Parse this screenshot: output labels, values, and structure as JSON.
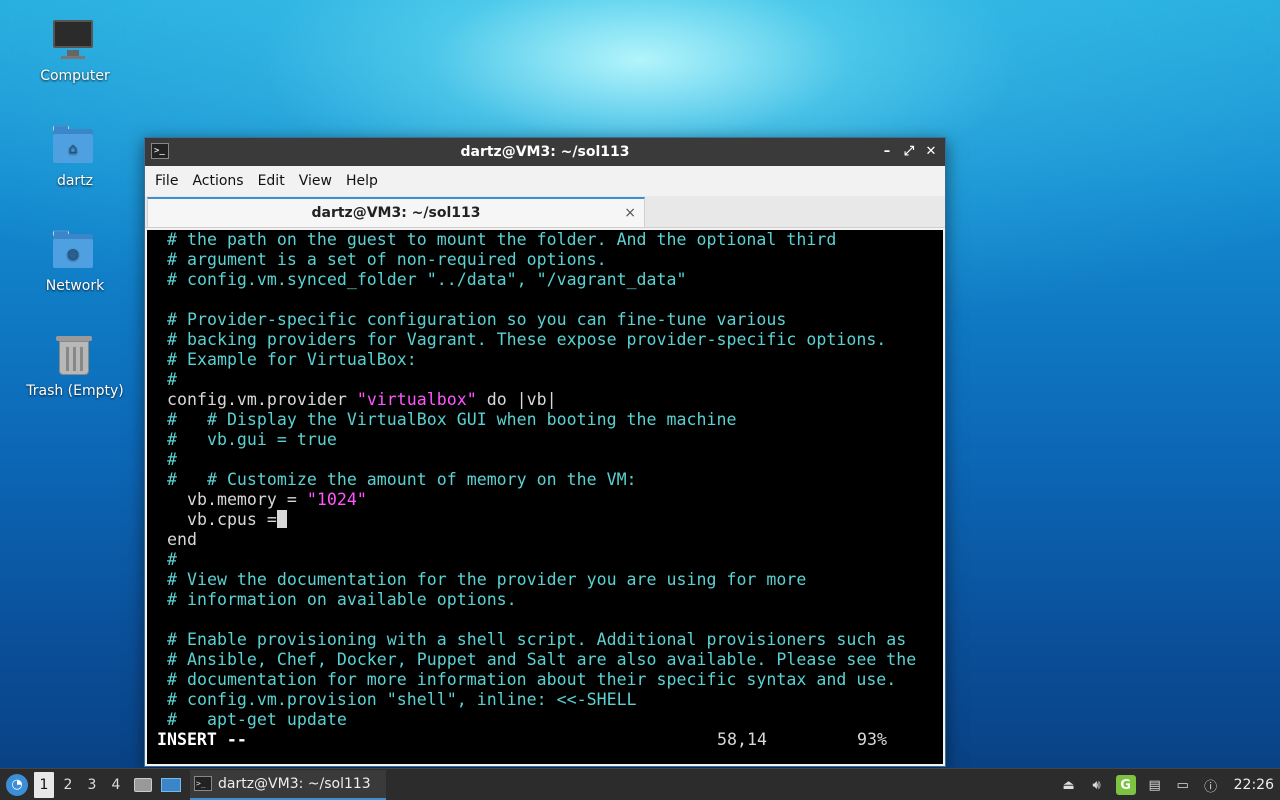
{
  "desktop": {
    "icons": [
      {
        "label": "Computer"
      },
      {
        "label": "dartz"
      },
      {
        "label": "Network"
      },
      {
        "label": "Trash (Empty)"
      }
    ]
  },
  "window": {
    "title": "dartz@VM3: ~/sol113",
    "controls": {
      "minimize": "–",
      "maximize": "⤢",
      "close": "✕"
    },
    "menu": [
      "File",
      "Actions",
      "Edit",
      "View",
      "Help"
    ],
    "tab": {
      "label": "dartz@VM3: ~/sol113",
      "close": "×"
    }
  },
  "terminal": {
    "lines": [
      [
        {
          "t": "# the path on the guest to mount the folder. And the optional third",
          "c": "cm"
        }
      ],
      [
        {
          "t": "# argument is a set of non-required options.",
          "c": "cm"
        }
      ],
      [
        {
          "t": "# config.vm.synced_folder \"../data\", \"/vagrant_data\"",
          "c": "cm"
        }
      ],
      [],
      [
        {
          "t": "# Provider-specific configuration so you can fine-tune various",
          "c": "cm"
        }
      ],
      [
        {
          "t": "# backing providers for Vagrant. These expose provider-specific options.",
          "c": "cm"
        }
      ],
      [
        {
          "t": "# Example for VirtualBox:",
          "c": "cm"
        }
      ],
      [
        {
          "t": "#",
          "c": "cm"
        }
      ],
      [
        {
          "t": "config.vm.provider ",
          "c": "code"
        },
        {
          "t": "\"virtualbox\"",
          "c": "str"
        },
        {
          "t": " do |vb|",
          "c": "code"
        }
      ],
      [
        {
          "t": "#   # Display the VirtualBox GUI when booting the machine",
          "c": "cm"
        }
      ],
      [
        {
          "t": "#   vb.gui = true",
          "c": "cm"
        }
      ],
      [
        {
          "t": "#",
          "c": "cm"
        }
      ],
      [
        {
          "t": "#   # Customize the amount of memory on the VM:",
          "c": "cm"
        }
      ],
      [
        {
          "t": "  vb.memory = ",
          "c": "code"
        },
        {
          "t": "\"1024\"",
          "c": "str"
        }
      ],
      [
        {
          "t": "  vb.cpus =",
          "c": "code"
        },
        {
          "t": "",
          "c": "cursor"
        }
      ],
      [
        {
          "t": "end",
          "c": "code"
        }
      ],
      [
        {
          "t": "#",
          "c": "cm"
        }
      ],
      [
        {
          "t": "# View the documentation for the provider you are using for more",
          "c": "cm"
        }
      ],
      [
        {
          "t": "# information on available options.",
          "c": "cm"
        }
      ],
      [],
      [
        {
          "t": "# Enable provisioning with a shell script. Additional provisioners such as",
          "c": "cm"
        }
      ],
      [
        {
          "t": "# Ansible, Chef, Docker, Puppet and Salt are also available. Please see the",
          "c": "cm"
        }
      ],
      [
        {
          "t": "# documentation for more information about their specific syntax and use.",
          "c": "cm"
        }
      ],
      [
        {
          "t": "# config.vm.provision \"shell\", inline: <<-SHELL",
          "c": "cm"
        }
      ],
      [
        {
          "t": "#   apt-get update",
          "c": "cm"
        }
      ]
    ],
    "status": {
      "mode": "-- INSERT --",
      "position": "58,14",
      "percent": "93%"
    }
  },
  "taskbar": {
    "workspaces": [
      "1",
      "2",
      "3",
      "4"
    ],
    "active_workspace": "1",
    "task_label": "dartz@VM3: ~/sol113",
    "clock": "22:26"
  }
}
